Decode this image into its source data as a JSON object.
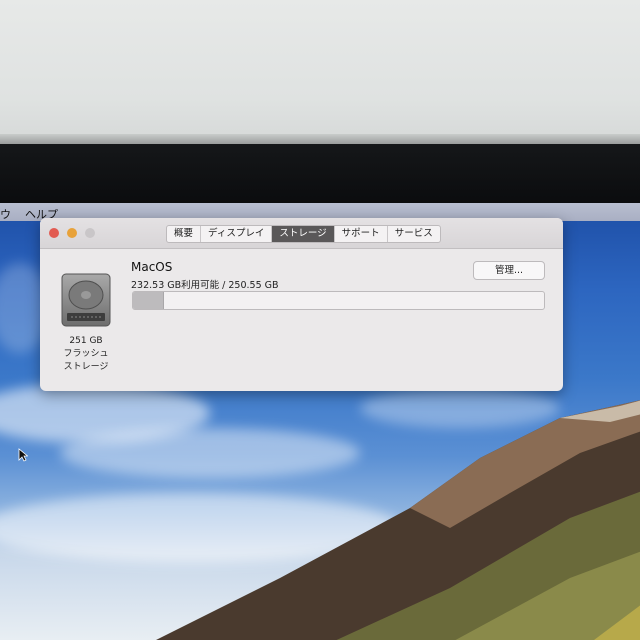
{
  "menubar": {
    "item_1": "ウ",
    "item_2": "ヘルプ"
  },
  "window": {
    "tabs": [
      {
        "label": "概要",
        "active": false
      },
      {
        "label": "ディスプレイ",
        "active": false
      },
      {
        "label": "ストレージ",
        "active": true
      },
      {
        "label": "サポート",
        "active": false
      },
      {
        "label": "サービス",
        "active": false
      }
    ],
    "traffic_lights": {
      "close": "#e25b52",
      "minimize": "#e8a23a",
      "zoom": "#c9c6c8"
    },
    "drive": {
      "icon": "hard-drive-icon",
      "capacity": "251 GB",
      "type_line1": "フラッシュ",
      "type_line2": "ストレージ"
    },
    "volume": {
      "name": "MacOS",
      "info": "232.53 GB利用可能 / 250.55 GB",
      "used_fraction": 0.072
    },
    "manage_button": "管理..."
  },
  "colors": {
    "active_tab": "#5a5859",
    "window_bg": "#ebe9ea"
  }
}
